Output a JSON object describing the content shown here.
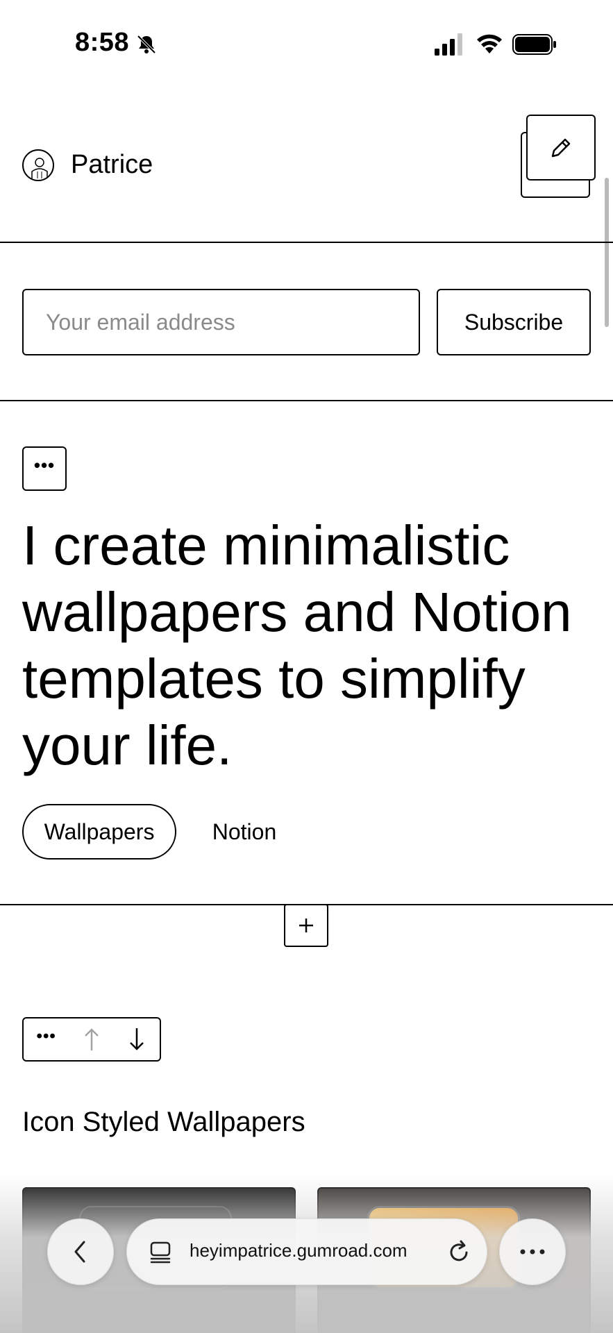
{
  "status_bar": {
    "time": "8:58",
    "icons": [
      "bell-slash-icon",
      "signal-icon",
      "wifi-icon",
      "battery-icon"
    ]
  },
  "header": {
    "profile_name": "Patrice",
    "avatar": "avatar-illustration",
    "edit_icon": "pencil-icon"
  },
  "subscribe": {
    "email_placeholder": "Your email address",
    "button_label": "Subscribe"
  },
  "bio": {
    "more_label": "•••",
    "heading": "I create minimalistic wallpapers and Notion templates to simplify your life.",
    "tags": [
      {
        "label": "Wallpapers",
        "selected": true
      },
      {
        "label": "Notion",
        "selected": false
      }
    ]
  },
  "add_section": {
    "icon": "plus-icon"
  },
  "section_controls": {
    "more_label": "•••",
    "icons": [
      "more-icon",
      "arrow-up-icon",
      "arrow-down-icon"
    ]
  },
  "products_section": {
    "title": "Icon Styled Wallpapers"
  },
  "browser": {
    "url": "heyimpatrice.gumroad.com",
    "icons": [
      "back-icon",
      "tabs-icon",
      "reload-icon",
      "more-icon"
    ]
  },
  "colors": {
    "text": "#000000",
    "placeholder": "#8a8a8a",
    "border": "#000000",
    "card_dark": "#111111",
    "card_accent": "#f5b13a"
  }
}
